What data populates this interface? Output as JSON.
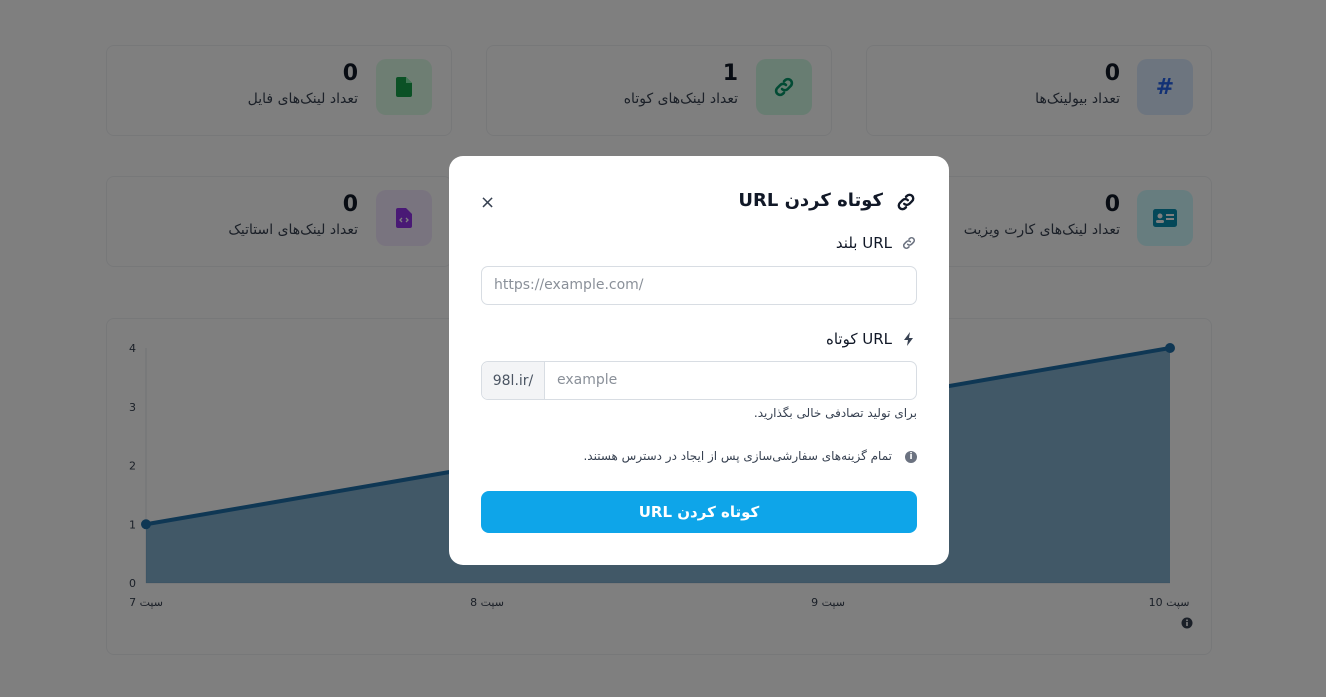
{
  "stats": [
    {
      "value": "0",
      "label": "تعداد لینک‌های فایل",
      "icon": "file-icon",
      "color": "#16a34a",
      "bg": "#dcfce7"
    },
    {
      "value": "1",
      "label": "تعداد لینک‌های کوتاه",
      "icon": "link-icon",
      "color": "#059669",
      "bg": "#d1fae5"
    },
    {
      "value": "0",
      "label": "تعداد بیولینک‌ها",
      "icon": "hash-icon",
      "color": "#2563eb",
      "bg": "#dbeafe"
    },
    {
      "value": "0",
      "label": "تعداد لینک‌های استاتیک",
      "icon": "code-file-icon",
      "color": "#9333ea",
      "bg": "#f3e8ff"
    },
    {
      "value": "0",
      "label": "تعداد لینک‌های کارت ویزیت",
      "icon": "id-card-icon",
      "color": "#0891b2",
      "bg": "#cffafe"
    }
  ],
  "chart_data": {
    "type": "area",
    "categories": [
      "7 سپت",
      "8 سپت",
      "9 سپت",
      "10 سپت"
    ],
    "values": [
      1,
      2,
      3,
      4
    ],
    "ylim": [
      0,
      4
    ],
    "yticks": [
      "0",
      "1",
      "2",
      "3",
      "4"
    ],
    "color": "#1e6fa8",
    "grid": false
  },
  "modal": {
    "title": "کوتاه کردن URL",
    "close": "×",
    "long_url_label": "URL بلند",
    "long_url_placeholder": "https://example.com/",
    "short_url_label": "URL کوتاه",
    "domain_prefix": "98l.ir/",
    "short_url_placeholder": "example",
    "short_url_help": "برای تولید تصادفی خالی بگذارید.",
    "info_note": "تمام گزینه‌های سفارشی‌سازی پس از ایجاد در دسترس هستند.",
    "submit_label": "کوتاه کردن URL"
  }
}
